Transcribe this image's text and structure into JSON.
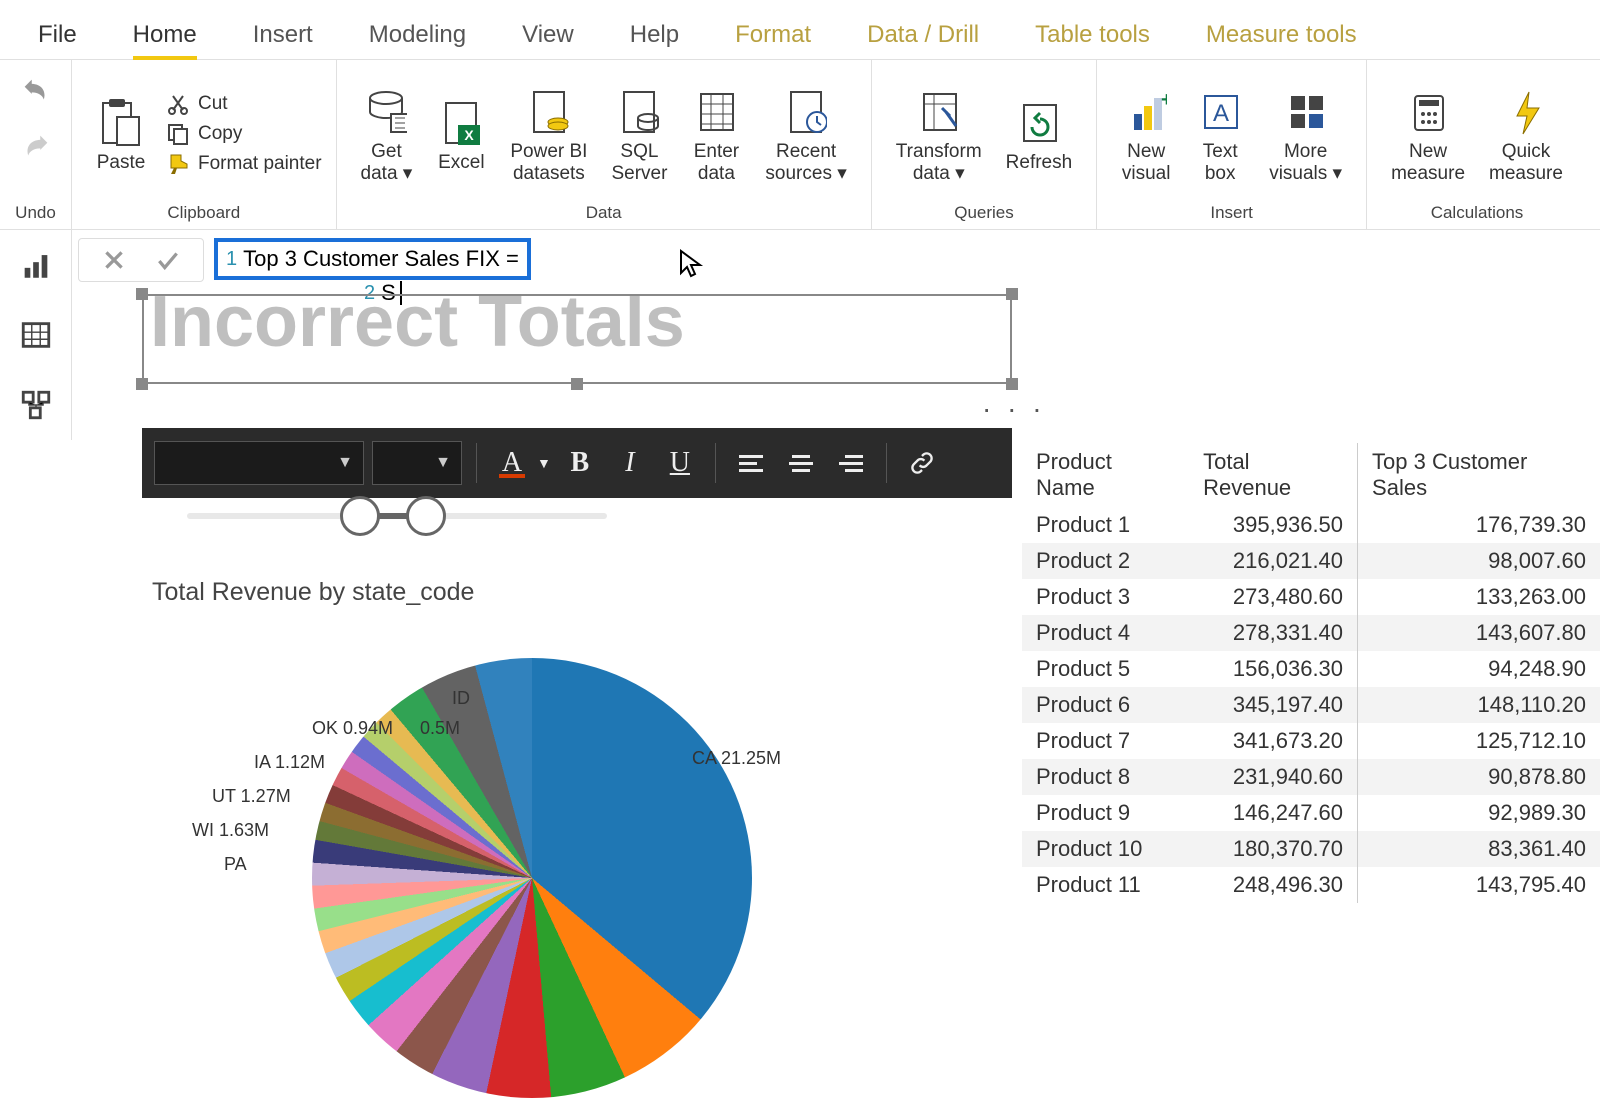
{
  "menu": {
    "file": "File",
    "home": "Home",
    "insert": "Insert",
    "modeling": "Modeling",
    "view": "View",
    "help": "Help",
    "format": "Format",
    "datadrill": "Data / Drill",
    "tabletools": "Table tools",
    "measuretools": "Measure tools"
  },
  "ribbon": {
    "undo": "Undo",
    "clipboard": {
      "label": "Clipboard",
      "paste": "Paste",
      "cut": "Cut",
      "copy": "Copy",
      "format_painter": "Format painter"
    },
    "data": {
      "label": "Data",
      "getdata": "Get\ndata",
      "excel": "Excel",
      "pbi": "Power BI\ndatasets",
      "sql": "SQL\nServer",
      "enter": "Enter\ndata",
      "recent": "Recent\nsources"
    },
    "queries": {
      "label": "Queries",
      "transform": "Transform\ndata",
      "refresh": "Refresh"
    },
    "insert": {
      "label": "Insert",
      "newvisual": "New\nvisual",
      "textbox": "Text\nbox",
      "morevisuals": "More\nvisuals"
    },
    "calc": {
      "label": "Calculations",
      "newmeasure": "New\nmeasure",
      "quickmeasure": "Quick\nmeasure"
    }
  },
  "formula": {
    "line1_num": "1",
    "line1": "Top 3 Customer Sales FIX =",
    "line2_num": "2",
    "line2": "S"
  },
  "title_visual": "Incorrect Totals",
  "pie_title": "Total Revenue by state_code",
  "pie_labels": {
    "ca": "CA 21.25M",
    "id": "ID",
    "id2": "0.5M",
    "ok": "OK 0.94M",
    "ia": "IA 1.12M",
    "ut": "UT 1.27M",
    "wi": "WI 1.63M",
    "pa": "PA"
  },
  "table": {
    "cols": [
      "Product Name",
      "Total Revenue",
      "Top 3 Customer Sales"
    ],
    "rows": [
      [
        "Product 1",
        "395,936.50",
        "176,739.30"
      ],
      [
        "Product 2",
        "216,021.40",
        "98,007.60"
      ],
      [
        "Product 3",
        "273,480.60",
        "133,263.00"
      ],
      [
        "Product 4",
        "278,331.40",
        "143,607.80"
      ],
      [
        "Product 5",
        "156,036.30",
        "94,248.90"
      ],
      [
        "Product 6",
        "345,197.40",
        "148,110.20"
      ],
      [
        "Product 7",
        "341,673.20",
        "125,712.10"
      ],
      [
        "Product 8",
        "231,940.60",
        "90,878.80"
      ],
      [
        "Product 9",
        "146,247.60",
        "92,989.30"
      ],
      [
        "Product 10",
        "180,370.70",
        "83,361.40"
      ],
      [
        "Product 11",
        "248,496.30",
        "143,795.40"
      ]
    ]
  },
  "chart_data": {
    "type": "pie",
    "title": "Total Revenue by state_code",
    "unit": "M",
    "series": [
      {
        "name": "Total Revenue",
        "values": [
          {
            "state": "CA",
            "value": 21.25
          },
          {
            "state": "WI",
            "value": 1.63
          },
          {
            "state": "UT",
            "value": 1.27
          },
          {
            "state": "IA",
            "value": 1.12
          },
          {
            "state": "OK",
            "value": 0.94
          },
          {
            "state": "ID",
            "value": 0.5
          },
          {
            "state": "PA",
            "value": null
          }
        ]
      }
    ]
  }
}
